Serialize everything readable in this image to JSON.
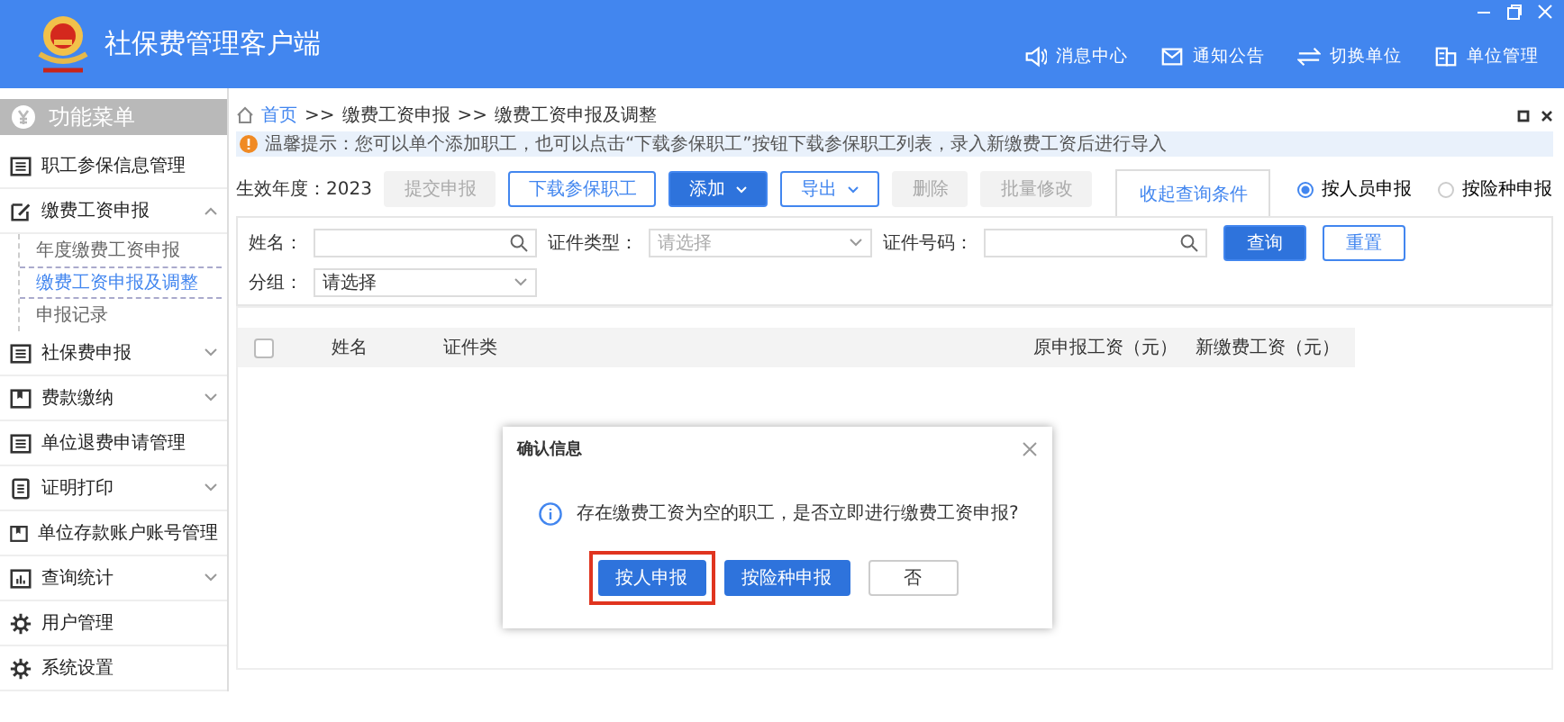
{
  "window": {
    "title": "社保费管理客户端"
  },
  "header_links": [
    {
      "label": "消息中心",
      "kind": "speaker"
    },
    {
      "label": "通知公告",
      "kind": "mail"
    },
    {
      "label": "切换单位",
      "kind": "swap"
    },
    {
      "label": "单位管理",
      "kind": "building"
    }
  ],
  "sidebar": {
    "title": "功能菜单",
    "items": [
      {
        "label": "职工参保信息管理",
        "kind": "card"
      },
      {
        "label": "缴费工资申报",
        "kind": "edit",
        "expanded": true,
        "children": [
          {
            "label": "年度缴费工资申报",
            "selected": false
          },
          {
            "label": "缴费工资申报及调整",
            "selected": true
          },
          {
            "label": "申报记录",
            "selected": false
          }
        ]
      },
      {
        "label": "社保费申报",
        "kind": "card",
        "expanded": false
      },
      {
        "label": "费款缴纳",
        "kind": "book",
        "expanded": false
      },
      {
        "label": "单位退费申请管理",
        "kind": "card"
      },
      {
        "label": "证明打印",
        "kind": "print",
        "expanded": false
      },
      {
        "label": "单位存款账户账号管理",
        "kind": "book"
      },
      {
        "label": "查询统计",
        "kind": "chart",
        "expanded": false
      },
      {
        "label": "用户管理",
        "kind": "gear"
      },
      {
        "label": "系统设置",
        "kind": "gear"
      }
    ]
  },
  "breadcrumb": {
    "separator": ">>",
    "items": [
      "首页",
      "缴费工资申报",
      "缴费工资申报及调整"
    ]
  },
  "notice": "温馨提示：您可以单个添加职工，也可以点击“下载参保职工”按钮下载参保职工列表，录入新缴费工资后进行导入",
  "toolbar": {
    "year_label": "生效年度：2023",
    "buttons": [
      {
        "label": "提交申报",
        "kind": "plain",
        "disabled": true
      },
      {
        "label": "下载参保职工",
        "kind": "outline",
        "disabled": false
      },
      {
        "label": "添加",
        "kind": "primary",
        "disabled": false,
        "dropdown": true
      },
      {
        "label": "导出",
        "kind": "outline",
        "disabled": false,
        "dropdown": true
      },
      {
        "label": "删除",
        "kind": "plain",
        "disabled": true
      },
      {
        "label": "批量修改",
        "kind": "plain",
        "disabled": true
      }
    ],
    "collapse_tab": "收起查询条件",
    "radios": [
      {
        "label": "按人员申报",
        "selected": true
      },
      {
        "label": "按险种申报",
        "selected": false
      }
    ]
  },
  "filters": {
    "rows": [
      [
        {
          "label": "姓名：",
          "kind": "search"
        },
        {
          "label": "证件类型：",
          "kind": "select",
          "placeholder": "请选择"
        },
        {
          "label": "证件号码：",
          "kind": "search"
        }
      ],
      [
        {
          "label": "分组：",
          "kind": "select",
          "value": "请选择"
        }
      ]
    ],
    "buttons": [
      {
        "label": "查询",
        "kind": "primary"
      },
      {
        "label": "重置",
        "kind": "outline"
      }
    ]
  },
  "table": {
    "select_all_checked": false,
    "columns": [
      "姓名",
      "证件类",
      "原申报工资（元）",
      "新缴费工资（元）"
    ]
  },
  "dialog": {
    "title": "确认信息",
    "message": "存在缴费工资为空的职工，是否立即进行缴费工资申报?",
    "buttons": [
      {
        "label": "按人申报",
        "kind": "primary",
        "highlighted": true
      },
      {
        "label": "按险种申报",
        "kind": "primary",
        "highlighted": false
      },
      {
        "label": "否",
        "kind": "plain",
        "highlighted": false
      }
    ]
  }
}
